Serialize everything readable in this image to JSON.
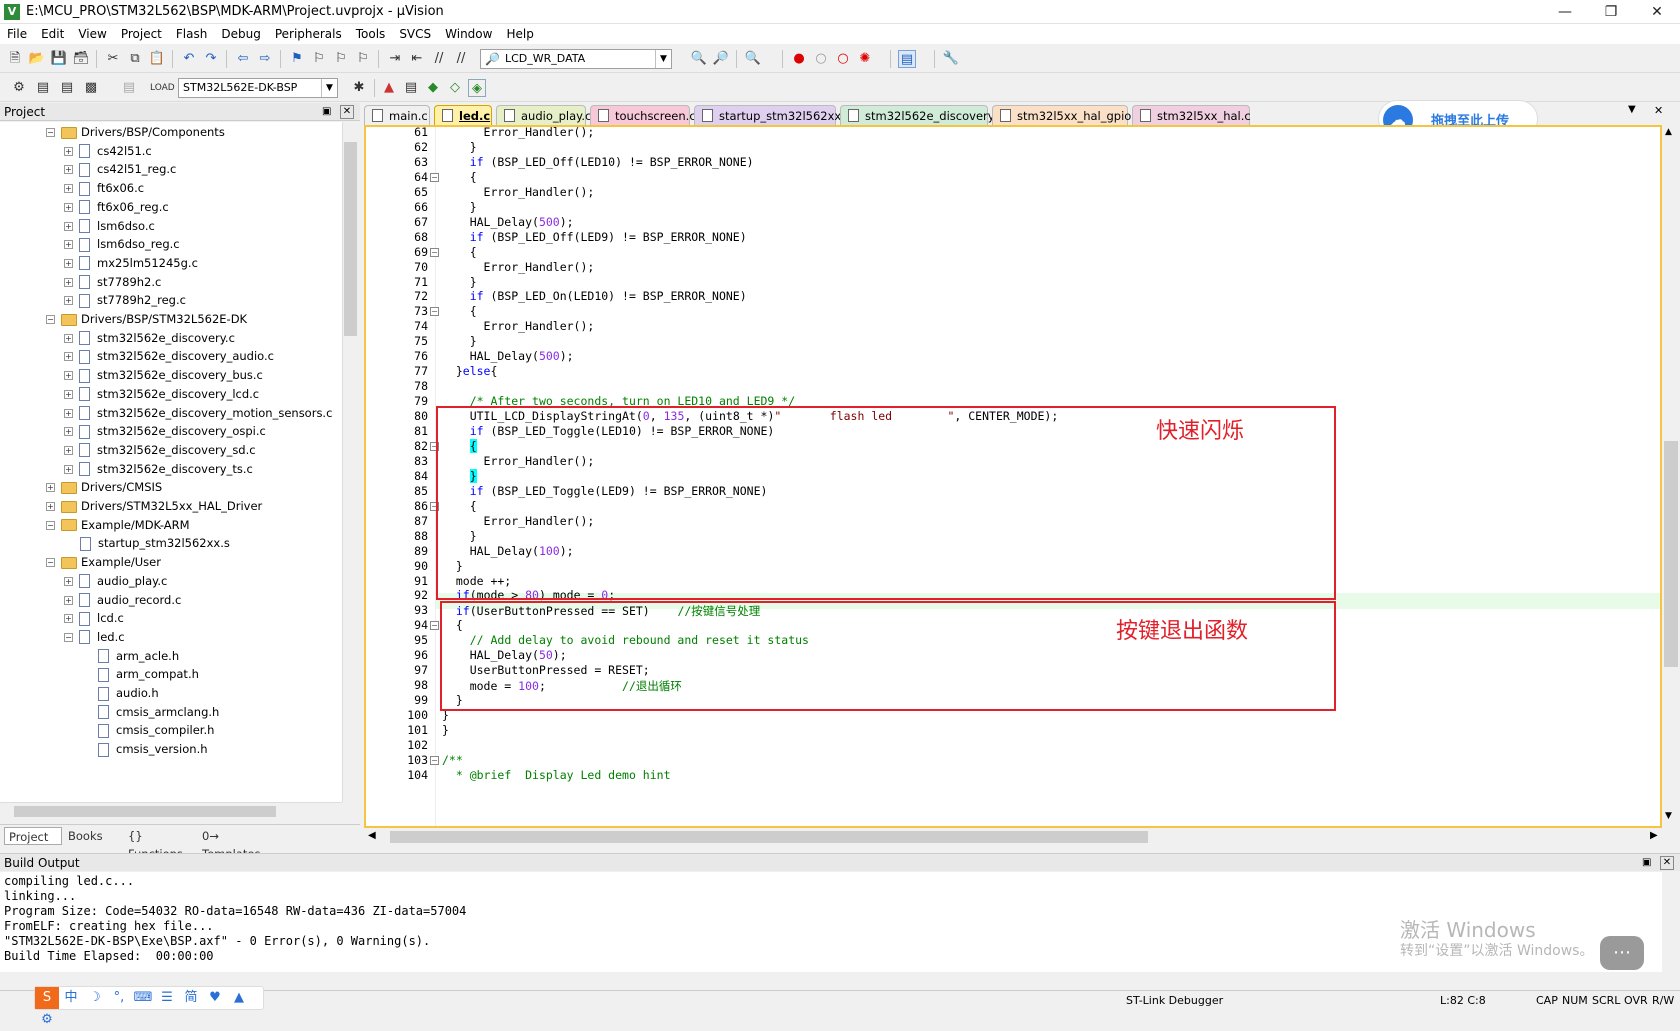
{
  "window": {
    "title": "E:\\MCU_PRO\\STM32L562\\BSP\\MDK-ARM\\Project.uvprojx - µVision",
    "min_icon": "minimize-icon",
    "max_icon": "restore-icon",
    "close_icon": "close-icon"
  },
  "menu": [
    "File",
    "Edit",
    "View",
    "Project",
    "Flash",
    "Debug",
    "Peripherals",
    "Tools",
    "SVCS",
    "Window",
    "Help"
  ],
  "toolbar1": {
    "find_combo": "LCD_WR_DATA"
  },
  "toolbar2": {
    "target_combo": "STM32L562E-DK-BSP"
  },
  "project_panel": {
    "title": "Project",
    "tree": [
      {
        "label": "Drivers/BSP/Components",
        "level": 1,
        "type": "folder",
        "expanded": true
      },
      {
        "label": "cs42l51.c",
        "level": 2,
        "type": "file"
      },
      {
        "label": "cs42l51_reg.c",
        "level": 2,
        "type": "file"
      },
      {
        "label": "ft6x06.c",
        "level": 2,
        "type": "file"
      },
      {
        "label": "ft6x06_reg.c",
        "level": 2,
        "type": "file"
      },
      {
        "label": "lsm6dso.c",
        "level": 2,
        "type": "file"
      },
      {
        "label": "lsm6dso_reg.c",
        "level": 2,
        "type": "file"
      },
      {
        "label": "mx25lm51245g.c",
        "level": 2,
        "type": "file"
      },
      {
        "label": "st7789h2.c",
        "level": 2,
        "type": "file"
      },
      {
        "label": "st7789h2_reg.c",
        "level": 2,
        "type": "file"
      },
      {
        "label": "Drivers/BSP/STM32L562E-DK",
        "level": 1,
        "type": "folder",
        "expanded": true
      },
      {
        "label": "stm32l562e_discovery.c",
        "level": 2,
        "type": "file"
      },
      {
        "label": "stm32l562e_discovery_audio.c",
        "level": 2,
        "type": "file"
      },
      {
        "label": "stm32l562e_discovery_bus.c",
        "level": 2,
        "type": "file"
      },
      {
        "label": "stm32l562e_discovery_lcd.c",
        "level": 2,
        "type": "file"
      },
      {
        "label": "stm32l562e_discovery_motion_sensors.c",
        "level": 2,
        "type": "file"
      },
      {
        "label": "stm32l562e_discovery_ospi.c",
        "level": 2,
        "type": "file"
      },
      {
        "label": "stm32l562e_discovery_sd.c",
        "level": 2,
        "type": "file"
      },
      {
        "label": "stm32l562e_discovery_ts.c",
        "level": 2,
        "type": "file"
      },
      {
        "label": "Drivers/CMSIS",
        "level": 1,
        "type": "folder",
        "expanded": false
      },
      {
        "label": "Drivers/STM32L5xx_HAL_Driver",
        "level": 1,
        "type": "folder",
        "expanded": false
      },
      {
        "label": "Example/MDK-ARM",
        "level": 1,
        "type": "folder",
        "expanded": true
      },
      {
        "label": "startup_stm32l562xx.s",
        "level": 2,
        "type": "file",
        "noexp": true
      },
      {
        "label": "Example/User",
        "level": 1,
        "type": "folder",
        "expanded": true
      },
      {
        "label": "audio_play.c",
        "level": 2,
        "type": "file"
      },
      {
        "label": "audio_record.c",
        "level": 2,
        "type": "file"
      },
      {
        "label": "lcd.c",
        "level": 2,
        "type": "file"
      },
      {
        "label": "led.c",
        "level": 2,
        "type": "file",
        "expanded": true
      },
      {
        "label": "arm_acle.h",
        "level": 3,
        "type": "file"
      },
      {
        "label": "arm_compat.h",
        "level": 3,
        "type": "file"
      },
      {
        "label": "audio.h",
        "level": 3,
        "type": "file"
      },
      {
        "label": "cmsis_armclang.h",
        "level": 3,
        "type": "file"
      },
      {
        "label": "cmsis_compiler.h",
        "level": 3,
        "type": "file"
      },
      {
        "label": "cmsis_version.h",
        "level": 3,
        "type": "file"
      }
    ],
    "tabs": [
      "Project",
      "Books",
      "{} Functions",
      "0→ Templates"
    ]
  },
  "editor_tabs": [
    {
      "label": "main.c",
      "color": "#f0f0f0"
    },
    {
      "label": "led.c",
      "color": "#fff2a8",
      "active": true
    },
    {
      "label": "audio_play.c",
      "color": "#e6f0c8"
    },
    {
      "label": "touchscreen.c",
      "color": "#f7c8d8"
    },
    {
      "label": "startup_stm32l562xx.s",
      "color": "#e0d0f0"
    },
    {
      "label": "stm32l562e_discovery.c",
      "color": "#d0ecd8"
    },
    {
      "label": "stm32l5xx_hal_gpio.c",
      "color": "#fbe0c8"
    },
    {
      "label": "stm32l5xx_hal.c",
      "color": "#f0d0e0"
    }
  ],
  "code": [
    {
      "n": "61",
      "t": "      Error_Handler();"
    },
    {
      "n": "62",
      "t": "    }"
    },
    {
      "n": "63",
      "t": "    if (BSP_LED_Off(LED10) != BSP_ERROR_NONE)"
    },
    {
      "n": "64",
      "t": "    {",
      "fold": true
    },
    {
      "n": "65",
      "t": "      Error_Handler();"
    },
    {
      "n": "66",
      "t": "    }"
    },
    {
      "n": "67",
      "t": "    HAL_Delay(500);"
    },
    {
      "n": "68",
      "t": "    if (BSP_LED_Off(LED9) != BSP_ERROR_NONE)"
    },
    {
      "n": "69",
      "t": "    {",
      "fold": true
    },
    {
      "n": "70",
      "t": "      Error_Handler();"
    },
    {
      "n": "71",
      "t": "    }"
    },
    {
      "n": "72",
      "t": "    if (BSP_LED_On(LED10) != BSP_ERROR_NONE)"
    },
    {
      "n": "73",
      "t": "    {",
      "fold": true
    },
    {
      "n": "74",
      "t": "      Error_Handler();"
    },
    {
      "n": "75",
      "t": "    }"
    },
    {
      "n": "76",
      "t": "    HAL_Delay(500);"
    },
    {
      "n": "77",
      "t": "  }else{"
    },
    {
      "n": "78",
      "t": ""
    },
    {
      "n": "79",
      "t": "    /* After two seconds, turn on LED10 and LED9 */"
    },
    {
      "n": "80",
      "t": "    UTIL_LCD_DisplayStringAt(0, 135, (uint8_t *)\"       flash led        \", CENTER_MODE);"
    },
    {
      "n": "81",
      "t": "    if (BSP_LED_Toggle(LED10) != BSP_ERROR_NONE)"
    },
    {
      "n": "82",
      "t": "    {",
      "fold": true
    },
    {
      "n": "83",
      "t": "      Error_Handler();"
    },
    {
      "n": "84",
      "t": "    }"
    },
    {
      "n": "85",
      "t": "    if (BSP_LED_Toggle(LED9) != BSP_ERROR_NONE)"
    },
    {
      "n": "86",
      "t": "    {",
      "fold": true
    },
    {
      "n": "87",
      "t": "      Error_Handler();"
    },
    {
      "n": "88",
      "t": "    }"
    },
    {
      "n": "89",
      "t": "    HAL_Delay(100);"
    },
    {
      "n": "90",
      "t": "  }"
    },
    {
      "n": "91",
      "t": "  mode ++;"
    },
    {
      "n": "92",
      "t": "  if(mode > 80) mode = 0;"
    },
    {
      "n": "93",
      "t": "  if(UserButtonPressed == SET)    //按键信号处理"
    },
    {
      "n": "94",
      "t": "  {",
      "fold": true
    },
    {
      "n": "95",
      "t": "    // Add delay to avoid rebound and reset it status"
    },
    {
      "n": "96",
      "t": "    HAL_Delay(50);"
    },
    {
      "n": "97",
      "t": "    UserButtonPressed = RESET;"
    },
    {
      "n": "98",
      "t": "    mode = 100;           //退出循环"
    },
    {
      "n": "99",
      "t": "  }"
    },
    {
      "n": "100",
      "t": "}"
    },
    {
      "n": "101",
      "t": "}"
    },
    {
      "n": "102",
      "t": ""
    },
    {
      "n": "103",
      "t": "/**",
      "fold": true
    },
    {
      "n": "104",
      "t": "  * @brief  Display Led demo hint"
    }
  ],
  "annotations": {
    "box1": "快速闪烁",
    "box2": "按键退出函数"
  },
  "baidu_button": "拖拽至此上传",
  "build_output": {
    "title": "Build Output",
    "lines": [
      "compiling led.c...",
      "linking...",
      "Program Size: Code=54032 RO-data=16548 RW-data=436 ZI-data=57004",
      "FromELF: creating hex file...",
      "\"STM32L562E-DK-BSP\\Exe\\BSP.axf\" - 0 Error(s), 0 Warning(s).",
      "Build Time Elapsed:  00:00:00"
    ]
  },
  "watermark": {
    "line1": "激活 Windows",
    "line2": "转到“设置”以激活 Windows。"
  },
  "status": {
    "debugger": "ST-Link Debugger",
    "position": "L:82 C:8",
    "cap": "CAP",
    "num": "NUM",
    "scrl": "SCRL",
    "ovr": "OVR",
    "rw": "R/W"
  },
  "ime": [
    "中",
    "☽",
    "°,",
    "⌨",
    "☰",
    "简",
    "♥",
    "▲",
    "⚙"
  ]
}
